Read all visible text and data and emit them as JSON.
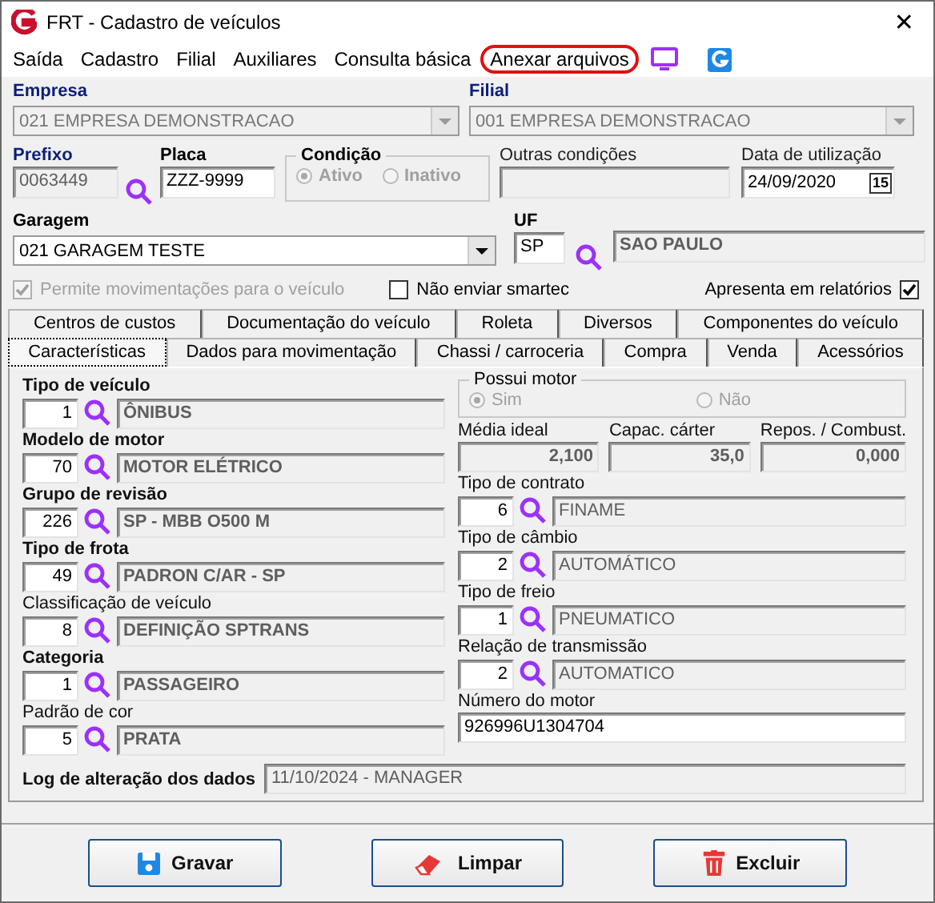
{
  "window": {
    "title": "FRT - Cadastro de veículos",
    "close": "✕"
  },
  "menu": [
    {
      "label": "Saída",
      "highlighted": false
    },
    {
      "label": "Cadastro",
      "highlighted": false
    },
    {
      "label": "Filial",
      "highlighted": false
    },
    {
      "label": "Auxiliares",
      "highlighted": false
    },
    {
      "label": "Consulta básica",
      "highlighted": false
    },
    {
      "label": "Anexar arquivos",
      "highlighted": true
    }
  ],
  "header": {
    "empresa": {
      "label": "Empresa",
      "value": "021 EMPRESA DEMONSTRACAO",
      "disabled": true
    },
    "filial": {
      "label": "Filial",
      "value": "001 EMPRESA DEMONSTRACAO",
      "disabled": true
    },
    "prefixo": {
      "label": "Prefixo",
      "value": "0063449",
      "disabled": true
    },
    "placa": {
      "label": "Placa",
      "value": "ZZZ-9999"
    },
    "condicao": {
      "label": "Condição",
      "disabled": true,
      "options": [
        {
          "label": "Ativo",
          "selected": true
        },
        {
          "label": "Inativo",
          "selected": false
        }
      ]
    },
    "outras": {
      "label": "Outras condições"
    },
    "data": {
      "label": "Data de utilização",
      "value": "24/09/2020",
      "button": "15"
    },
    "garagem": {
      "label": "Garagem",
      "value": "021 GARAGEM TESTE"
    },
    "uf": {
      "label": "UF",
      "code": "SP",
      "name": "SAO PAULO"
    }
  },
  "options": [
    {
      "label": "Permite movimentações para o veículo",
      "checked": true,
      "disabled": true
    },
    {
      "label": "Não enviar smartec",
      "checked": false,
      "disabled": false
    },
    {
      "label": "Apresenta em relatórios",
      "checked": true,
      "disabled": false
    }
  ],
  "tabs": [
    [
      {
        "label": "Centros de custos",
        "selected": false
      },
      {
        "label": "Documentação do veículo",
        "selected": false
      },
      {
        "label": "Roleta",
        "selected": false
      },
      {
        "label": "Diversos",
        "selected": false
      },
      {
        "label": "Componentes do veículo",
        "selected": false
      }
    ],
    [
      {
        "label": "Características",
        "selected": true
      },
      {
        "label": "Dados para movimentação",
        "selected": false
      },
      {
        "label": "Chassi / carroceria",
        "selected": false
      },
      {
        "label": "Compra",
        "selected": false
      },
      {
        "label": "Venda",
        "selected": false
      },
      {
        "label": "Acessórios",
        "selected": false
      }
    ]
  ],
  "left": [
    {
      "label": "Tipo de veículo",
      "required": true,
      "code": "1",
      "description": "ÔNIBUS"
    },
    {
      "label": "Modelo de motor",
      "required": true,
      "code": "70",
      "description": "MOTOR ELÉTRICO"
    },
    {
      "label": "Grupo de revisão",
      "required": true,
      "code": "226",
      "description": "SP - MBB O500 M"
    },
    {
      "label": "Tipo de frota",
      "required": true,
      "code": "49",
      "description": "PADRON C/AR - SP"
    },
    {
      "label": "Classificação de veículo",
      "required": false,
      "code": "8",
      "description": "DEFINIÇÃO SPTRANS"
    },
    {
      "label": "Categoria",
      "required": true,
      "code": "1",
      "description": "PASSAGEIRO"
    },
    {
      "label": "Padrão de cor",
      "required": false,
      "code": "5",
      "description": "PRATA"
    }
  ],
  "motor": {
    "label": "Possui motor",
    "disabled": true,
    "options": [
      {
        "label": "Sim",
        "selected": true
      },
      {
        "label": "Não",
        "selected": false
      }
    ]
  },
  "metrics": [
    {
      "label": "Média ideal",
      "value": "2,100"
    },
    {
      "label": "Capac. cárter",
      "value": "35,0"
    },
    {
      "label": "Repos. / Combust.",
      "value": "0,000"
    }
  ],
  "right": [
    {
      "label": "Tipo de contrato",
      "code": "6",
      "description": "FINAME"
    },
    {
      "label": "Tipo de câmbio",
      "code": "2",
      "description": "AUTOMÁTICO"
    },
    {
      "label": "Tipo de freio",
      "code": "1",
      "description": "PNEUMATICO"
    },
    {
      "label": "Relação de transmissão",
      "code": "2",
      "description": "AUTOMATICO"
    }
  ],
  "engine_number": {
    "label": "Número do motor",
    "value": "926996U1304704"
  },
  "log": {
    "label": "Log de alteração dos dados",
    "value": "11/10/2024 - MANAGER"
  },
  "buttons": [
    {
      "label": "Gravar",
      "kind": "save"
    },
    {
      "label": "Limpar",
      "kind": "clear"
    },
    {
      "label": "Excluir",
      "kind": "delete"
    }
  ]
}
